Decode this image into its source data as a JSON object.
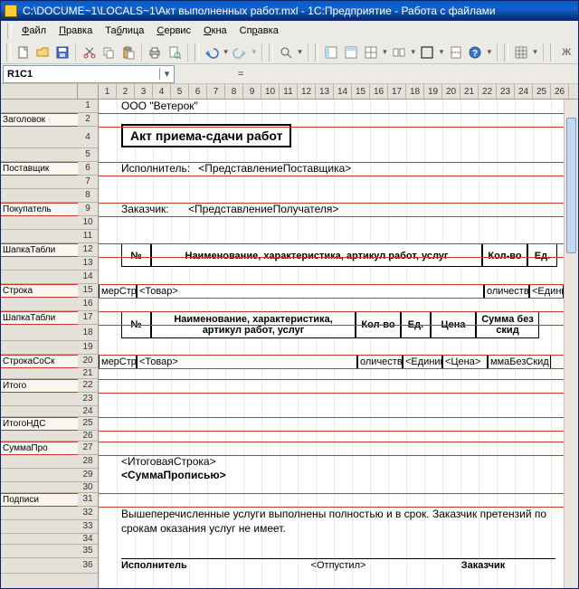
{
  "title": "C:\\DOCUME~1\\LOCALS~1\\Акт выполненных работ.mxl - 1С:Предприятие - Работа с файлами",
  "menu": {
    "file": "Файл",
    "edit": "Правка",
    "table": "Таблица",
    "service": "Сервис",
    "windows": "Окна",
    "help": "Справка"
  },
  "cellref": {
    "name": "R1C1",
    "fx_eq": "="
  },
  "cols": [
    "1",
    "2",
    "3",
    "4",
    "5",
    "6",
    "7",
    "8",
    "9",
    "10",
    "11",
    "12",
    "13",
    "14",
    "15",
    "16",
    "17",
    "18",
    "19",
    "20",
    "21",
    "22",
    "23",
    "24",
    "25",
    "26"
  ],
  "rows": [
    "1",
    "2",
    "4",
    "5",
    "6",
    "7",
    "8",
    "9",
    "10",
    "11",
    "12",
    "13",
    "14",
    "15",
    "16",
    "17",
    "18",
    "19",
    "20",
    "21",
    "22",
    "23",
    "24",
    "25",
    "26",
    "27",
    "28",
    "29",
    "30",
    "31",
    "32",
    "33",
    "34",
    "35",
    "36"
  ],
  "sections": {
    "zagolovok": "Заголовок",
    "postavshik": "Поставщик",
    "pokupatel": "Покупатель",
    "shapka1": "ШапкаТабли",
    "stroka": "Строка",
    "shapka2": "ШапкаТабли",
    "strokaCoSk": "СтрокаСоСк",
    "itogo": "Итого",
    "itogoNds": "ИтогоНДС",
    "summaProp": "СуммаПро",
    "podpisi": "Подписи"
  },
  "content": {
    "org": "ООО \"Ветерок\"",
    "big_title": "Акт приема-сдачи работ",
    "ispolnitel_lbl": "Исполнитель:",
    "ispolnitel_ph": "<ПредставлениеПоставщика>",
    "zakazchik_lbl": "Заказчик:",
    "zakazchik_ph": "<ПредставлениеПолучателя>",
    "th_num": "№",
    "th_name": "Наименование, характеристика, артикул работ, услуг",
    "th_qty": "Кол-во",
    "th_unit": "Ед.",
    "th_price": "Цена",
    "th_sum": "Сумма без скид",
    "th_name2": "Наименование, характеристика, артикул работ, услуг",
    "row_num": "мерСтро",
    "row_tovar": "<Товар>",
    "row_qty": "оличество>",
    "row_unit": "<Единиц",
    "row_price": "<Цена>",
    "row_sum": "ммаБезСкид",
    "itog_row": "<ИтоговаяСтрока>",
    "summa_prop": "<СуммаПрописью>",
    "text1": "Вышеперечисленные услуги выполнены полностью и в срок. Заказчик претензий по срокам оказания услуг не имеет.",
    "sign_isp": "Исполнитель",
    "sign_otp": "<Отпустил>",
    "sign_zak": "Заказчик"
  }
}
